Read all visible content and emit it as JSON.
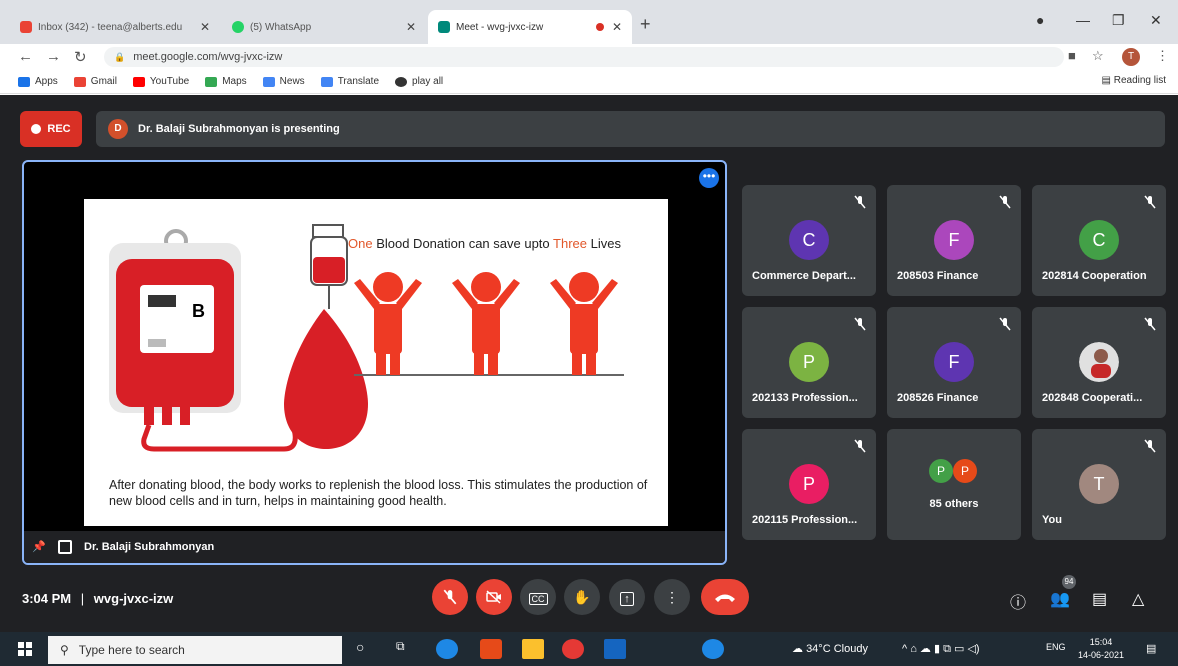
{
  "browser": {
    "tabs": [
      {
        "label": "Inbox (342) - teena@alberts.edu",
        "favicon": "gmail-icon"
      },
      {
        "label": "(5) WhatsApp",
        "favicon": "whatsapp-icon"
      },
      {
        "label": "Meet - wvg-jvxc-izw",
        "favicon": "meet-icon"
      }
    ],
    "url": "meet.google.com/wvg-jvxc-izw",
    "profile_initial": "T",
    "bookmarks": [
      "Apps",
      "Gmail",
      "YouTube",
      "Maps",
      "News",
      "Translate",
      "play all"
    ],
    "reading_list": "Reading list"
  },
  "meet": {
    "rec_label": "REC",
    "presenter_initial": "D",
    "presenting_text": "Dr. Balaji Subrahmonyan is presenting",
    "slide": {
      "title_parts": [
        "One",
        " Blood Donation can save upto ",
        "Three",
        " Lives"
      ],
      "bag_label": "B",
      "body": "After donating blood, the body works to replenish the blood loss. This stimulates the production of new blood cells and in turn, helps in maintaining good health."
    },
    "presenter_name": "Dr. Balaji Subrahmonyan",
    "participants": [
      {
        "initial": "C",
        "name": "Commerce Depart...",
        "color": "#5e35b1"
      },
      {
        "initial": "F",
        "name": "208503 Finance",
        "color": "#ab47bc"
      },
      {
        "initial": "C",
        "name": "202814 Cooperation",
        "color": "#43a047"
      },
      {
        "initial": "P",
        "name": "202133 Profession...",
        "color": "#7cb342"
      },
      {
        "initial": "F",
        "name": "208526 Finance",
        "color": "#5e35b1"
      },
      {
        "initial": "",
        "name": "202848 Cooperati...",
        "color": "#cfd8dc"
      },
      {
        "initial": "P",
        "name": "202115 Profession...",
        "color": "#e91e63"
      },
      {
        "initial": "",
        "name": "85 others",
        "color": "#3c4043"
      },
      {
        "initial": "T",
        "name": "You",
        "color": "#a1887f"
      }
    ],
    "others_avatars": [
      {
        "initial": "P",
        "color": "#43a047"
      },
      {
        "initial": "P",
        "color": "#e64a19"
      }
    ],
    "time": "3:04 PM",
    "separator": "|",
    "meeting_code": "wvg-jvxc-izw",
    "participant_count": "94"
  },
  "taskbar": {
    "search_placeholder": "Type here to search",
    "weather": "34°C  Cloudy",
    "lang": "ENG",
    "time": "15:04",
    "date": "14-06-2021"
  }
}
